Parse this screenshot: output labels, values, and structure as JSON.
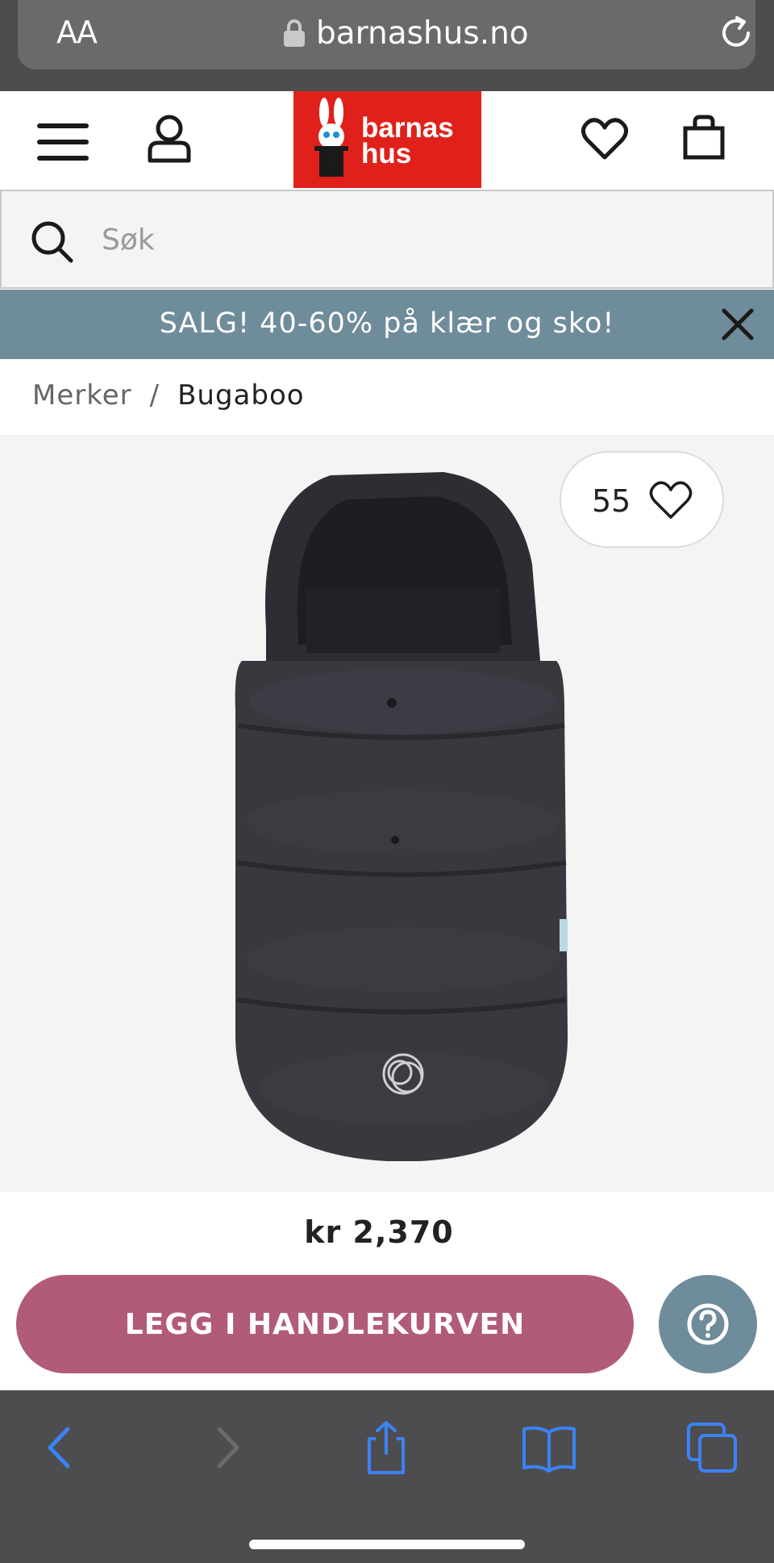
{
  "browser": {
    "text_size_button": "AA",
    "url": "barnashus.no"
  },
  "header": {
    "logo_line1": "barnas",
    "logo_line2": "hus"
  },
  "search": {
    "placeholder": "Søk"
  },
  "promo": {
    "text": "SALG! 40-60% på klær og sko!"
  },
  "breadcrumb": {
    "items": [
      "Merker",
      "Bugaboo"
    ],
    "separator": "/"
  },
  "product": {
    "like_count": "55",
    "price": "kr 2,370",
    "add_to_cart_label": "LEGG I HANDLEKURVEN"
  },
  "colors": {
    "brand_red": "#e0211b",
    "promo_bg": "#6f8c9b",
    "cta_pink": "#b15a79",
    "safari_blue": "#3b82f6"
  },
  "icons": {
    "menu": "hamburger-icon",
    "account": "user-icon",
    "wishlist": "heart-icon",
    "cart": "bag-icon",
    "search": "search-icon",
    "close": "close-icon",
    "help": "question-icon"
  }
}
